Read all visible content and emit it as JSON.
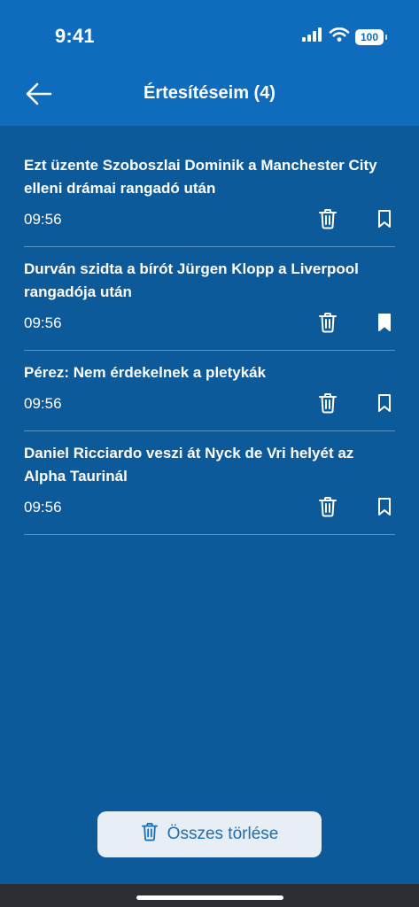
{
  "status": {
    "time": "9:41",
    "battery": "100"
  },
  "header": {
    "title": "Értesítéseim (4)"
  },
  "notifications": [
    {
      "title": "Ezt üzente Szoboszlai Dominik a Manchester City elleni drámai rangadó után",
      "time": "09:56",
      "bookmarked": false
    },
    {
      "title": "Durván szidta a bírót Jürgen Klopp a Liverpool rangadója után",
      "time": "09:56",
      "bookmarked": true
    },
    {
      "title": "Pérez: Nem érdekelnek a pletykák",
      "time": "09:56",
      "bookmarked": false
    },
    {
      "title": "Daniel Ricciardo veszi át Nyck de Vri helyét az Alpha Taurinál",
      "time": "09:56",
      "bookmarked": false
    }
  ],
  "footer": {
    "delete_all_label": "Összes törlése"
  },
  "icons": {
    "back": "arrow-left-icon",
    "trash": "trash-icon",
    "bookmark": "bookmark-icon",
    "bookmark_filled": "bookmark-filled-icon"
  },
  "colors": {
    "header": "#0f6cbc",
    "background": "#0d5a9a",
    "button_bg": "#e8eef5",
    "button_text": "#1a6fb5"
  }
}
